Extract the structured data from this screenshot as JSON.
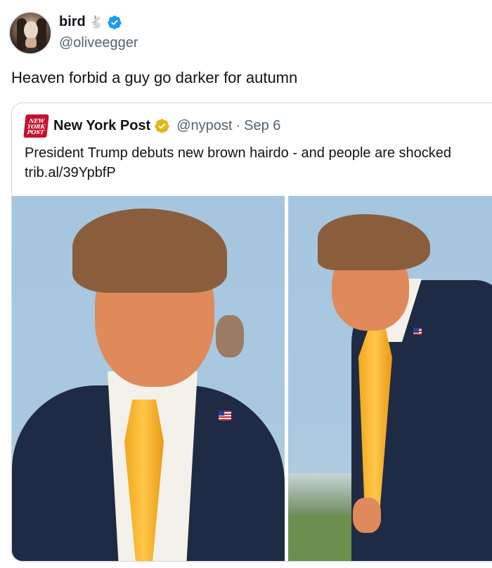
{
  "author": {
    "display_name": "bird",
    "emoji": "🐇",
    "handle": "@oliveegger",
    "verified": true
  },
  "tweet": {
    "text": "Heaven forbid a guy go darker for autumn"
  },
  "quote": {
    "logo_text": [
      "NEW",
      "YORK",
      "POST"
    ],
    "name": "New York Post",
    "handle": "@nypost",
    "separator": "·",
    "date": "Sep 6",
    "text": "President Trump debuts new brown hairdo - and people are shocked",
    "link": "trib.al/39YpbfP",
    "photos": [
      "photo-left",
      "photo-right"
    ]
  },
  "colors": {
    "verified_blue": "#1d9bf0",
    "gold_badge": "#e2b719",
    "brand_red": "#c8102e",
    "secondary_text": "#536471"
  }
}
